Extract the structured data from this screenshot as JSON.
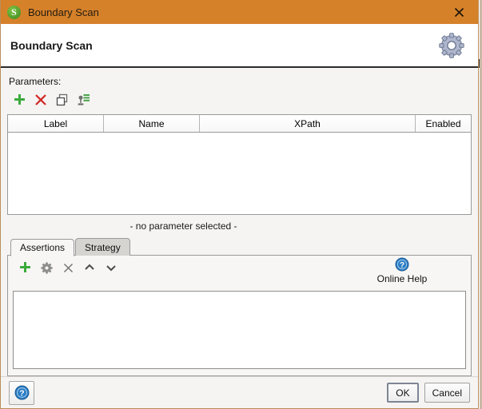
{
  "window": {
    "title": "Boundary Scan",
    "app_icon": "soapui-s-icon",
    "close_icon": "close-icon",
    "titlebar_color": "#d5812a"
  },
  "header": {
    "title": "Boundary Scan",
    "gear_icon": "gear-icon"
  },
  "parameters": {
    "section_label": "Parameters:",
    "toolbar": [
      {
        "name": "add-parameter-button",
        "icon": "plus-icon",
        "color": "#3caa3c"
      },
      {
        "name": "remove-parameter-button",
        "icon": "x-icon",
        "color": "#d22b27"
      },
      {
        "name": "copy-parameter-button",
        "icon": "copy-icon",
        "color": "#555555"
      },
      {
        "name": "parameter-properties-button",
        "icon": "properties-icon",
        "color": "#6f6f6f"
      }
    ],
    "columns": [
      "Label",
      "Name",
      "XPath",
      "Enabled"
    ],
    "rows": [],
    "empty_message": "- no parameter selected -"
  },
  "tabs": [
    {
      "label": "Assertions",
      "active": true
    },
    {
      "label": "Strategy",
      "active": false
    }
  ],
  "assertions": {
    "toolbar": [
      {
        "name": "add-assertion-button",
        "icon": "plus-icon",
        "color": "#3caa3c"
      },
      {
        "name": "configure-assertion-button",
        "icon": "gear-icon",
        "color": "#8a8a8a"
      },
      {
        "name": "delete-assertion-button",
        "icon": "x-icon",
        "color": "#6f6f6f"
      },
      {
        "name": "move-assertion-up-button",
        "icon": "chevron-up-icon",
        "color": "#4a4a4a"
      },
      {
        "name": "move-assertion-down-button",
        "icon": "chevron-down-icon",
        "color": "#4a4a4a"
      }
    ],
    "online_help": {
      "label": "Online Help",
      "icon": "help-circle-icon",
      "color": "#2b7cc4"
    },
    "items": []
  },
  "footer": {
    "help_icon": "help-circle-icon",
    "ok_label": "OK",
    "cancel_label": "Cancel"
  }
}
